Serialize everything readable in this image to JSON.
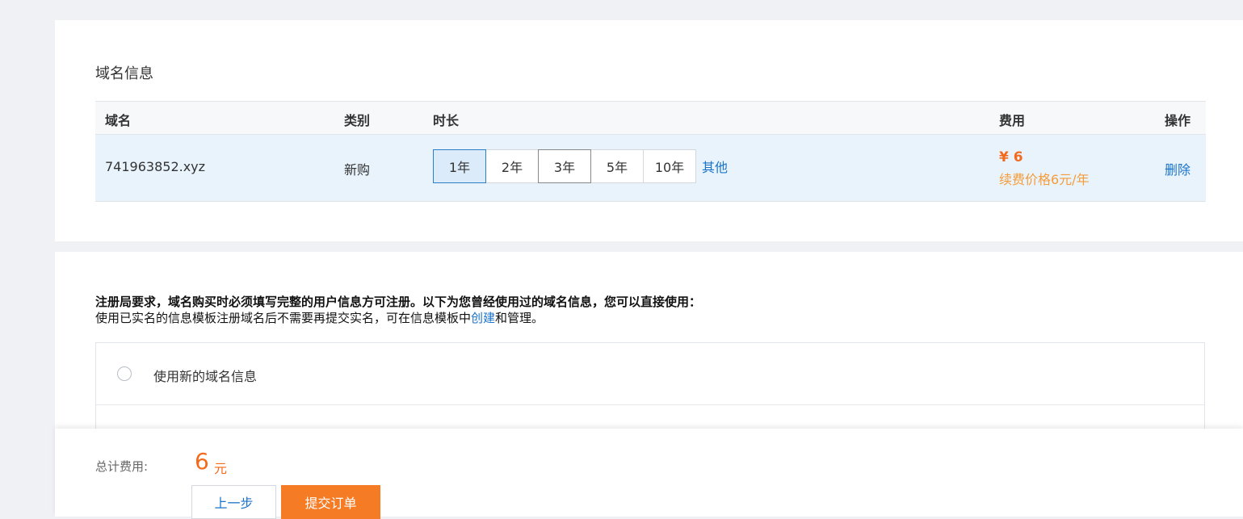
{
  "domain_section": {
    "title": "域名信息",
    "headers": {
      "domain": "域名",
      "type": "类别",
      "duration": "时长",
      "fee": "费用",
      "action": "操作"
    },
    "row": {
      "domain": "741963852.xyz",
      "type": "新购",
      "durations": [
        "1年",
        "2年",
        "3年",
        "5年",
        "10年"
      ],
      "selected_duration": "1年",
      "other": "其他",
      "price": "¥ 6",
      "renew": "续费价格6元/年",
      "delete": "删除"
    }
  },
  "info_section": {
    "notice_bold": "注册局要求，域名购买时必须填写完整的用户信息方可注册。以下为您曾经使用过的域名信息，您可以直接使用：",
    "notice_pre": "使用已实名的信息模板注册域名后不需要再提交实名，可在信息模板中",
    "notice_link": "创建",
    "notice_post": "和管理。",
    "options": [
      {
        "label": "使用新的域名信息"
      }
    ]
  },
  "footer": {
    "total_label": "总计费用:",
    "total_value": "6",
    "total_unit": "元",
    "prev_label": "上一步",
    "submit_label": "提交订单"
  },
  "colors": {
    "accent_orange": "#f57b24",
    "link_blue": "#1a73c9",
    "selected_bg": "#dcebf9"
  }
}
